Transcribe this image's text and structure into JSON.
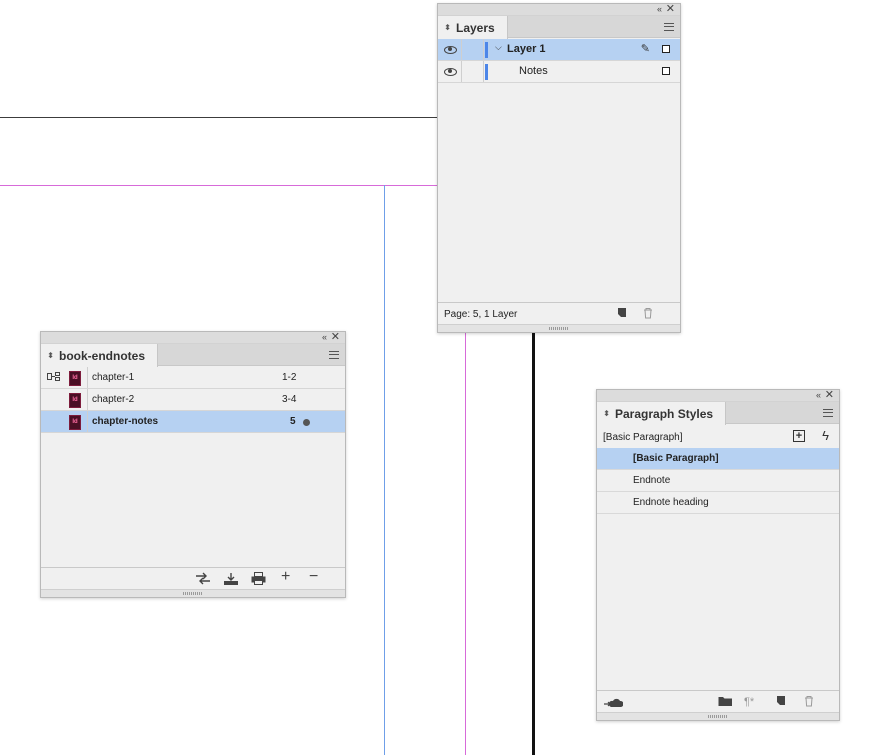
{
  "layers_panel": {
    "tab": "Layers",
    "rows": [
      {
        "name": "Layer 1",
        "selected": true,
        "expanded": true,
        "color": "#4d86e8"
      },
      {
        "name": "Notes",
        "selected": false,
        "color": "#4d86e8"
      }
    ],
    "status": "Page: 5, 1 Layer"
  },
  "book_panel": {
    "tab": "book-endnotes",
    "documents": [
      {
        "name": "chapter-1",
        "pages": "1-2",
        "style_source": true
      },
      {
        "name": "chapter-2",
        "pages": "3-4"
      },
      {
        "name": "chapter-notes",
        "pages": "5",
        "open": true,
        "selected": true
      }
    ],
    "doc_badge": "Id"
  },
  "paragraph_styles_panel": {
    "tab": "Paragraph Styles",
    "current_style": "[Basic Paragraph]",
    "styles": [
      {
        "name": "[Basic Paragraph]",
        "selected": true
      },
      {
        "name": "Endnote"
      },
      {
        "name": "Endnote heading"
      }
    ]
  },
  "icons": {
    "collapse": "«",
    "close": "✕",
    "tab_updown": "⬍",
    "pen": "✎",
    "bolt": "ϟ",
    "new_style": "+",
    "twisty": "⌵"
  },
  "colors": {
    "selection": "#b6d1f2",
    "guide_magenta": "#d76ad9",
    "guide_blue": "#6f9fe8",
    "layer_color": "#4d86e8"
  }
}
